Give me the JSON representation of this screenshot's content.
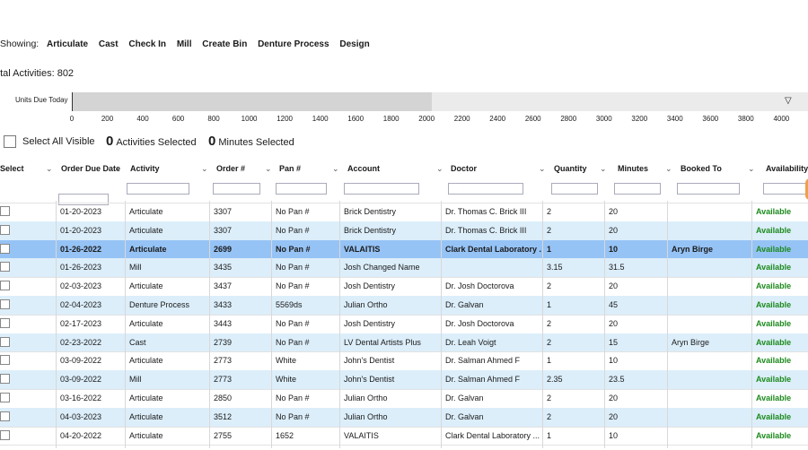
{
  "filters": {
    "label": "Showing:",
    "items": [
      "Articulate",
      "Cast",
      "Check In",
      "Mill",
      "Create Bin",
      "Denture Process",
      "Design"
    ]
  },
  "total_activities": "otal Activities: 802",
  "units_chart": {
    "label": "Units Due Today",
    "axis_ticks": [
      "0",
      "200",
      "400",
      "600",
      "800",
      "1000",
      "1200",
      "1400",
      "1600",
      "1800",
      "2000",
      "2200",
      "2400",
      "2600",
      "2800",
      "3000",
      "3200",
      "3400",
      "3600",
      "3800",
      "4000"
    ],
    "axis_max": 4150,
    "fill_value": 2030
  },
  "select_all_label": "Select All Visible",
  "activities_selected": {
    "count": "0",
    "label": "Activities Selected"
  },
  "minutes_selected": {
    "count": "0",
    "label": "Minutes Selected"
  },
  "columns": [
    "Select",
    "Order Due Date",
    "Activity",
    "Order #",
    "Pan #",
    "Account",
    "Doctor",
    "Quantity",
    "Minutes",
    "Booked To",
    "Availability"
  ],
  "rows": [
    {
      "date": "01-20-2023",
      "activity": "Articulate",
      "order": "3307",
      "pan": "No Pan #",
      "account": "Brick Dentistry",
      "doctor": "Dr. Thomas C. Brick III",
      "qty": "2",
      "min": "20",
      "booked": "",
      "avail": "Available"
    },
    {
      "date": "01-20-2023",
      "activity": "Articulate",
      "order": "3307",
      "pan": "No Pan #",
      "account": "Brick Dentistry",
      "doctor": "Dr. Thomas C. Brick III",
      "qty": "2",
      "min": "20",
      "booked": "",
      "avail": "Available"
    },
    {
      "date": "01-26-2022",
      "activity": "Articulate",
      "order": "2699",
      "pan": "No Pan #",
      "account": "VALAITIS",
      "doctor": "Clark Dental Laboratory ...",
      "qty": "1",
      "min": "10",
      "booked": "Aryn Birge",
      "avail": "Available"
    },
    {
      "date": "01-26-2023",
      "activity": "Mill",
      "order": "3435",
      "pan": "No Pan #",
      "account": "Josh Changed Name",
      "doctor": "",
      "qty": "3.15",
      "min": "31.5",
      "booked": "",
      "avail": "Available"
    },
    {
      "date": "02-03-2023",
      "activity": "Articulate",
      "order": "3437",
      "pan": "No Pan #",
      "account": "Josh Dentistry",
      "doctor": "Dr. Josh Doctorova",
      "qty": "2",
      "min": "20",
      "booked": "",
      "avail": "Available"
    },
    {
      "date": "02-04-2023",
      "activity": "Denture Process",
      "order": "3433",
      "pan": "5569ds",
      "account": "Julian Ortho",
      "doctor": "Dr. Galvan",
      "qty": "1",
      "min": "45",
      "booked": "",
      "avail": "Available"
    },
    {
      "date": "02-17-2023",
      "activity": "Articulate",
      "order": "3443",
      "pan": "No Pan #",
      "account": "Josh Dentistry",
      "doctor": "Dr. Josh Doctorova",
      "qty": "2",
      "min": "20",
      "booked": "",
      "avail": "Available"
    },
    {
      "date": "02-23-2022",
      "activity": "Cast",
      "order": "2739",
      "pan": "No Pan #",
      "account": "LV Dental Artists Plus",
      "doctor": "Dr. Leah Voigt",
      "qty": "2",
      "min": "15",
      "booked": "Aryn Birge",
      "avail": "Available"
    },
    {
      "date": "03-09-2022",
      "activity": "Articulate",
      "order": "2773",
      "pan": "White",
      "account": "John's Dentist",
      "doctor": "Dr. Salman Ahmed F",
      "qty": "1",
      "min": "10",
      "booked": "",
      "avail": "Available"
    },
    {
      "date": "03-09-2022",
      "activity": "Mill",
      "order": "2773",
      "pan": "White",
      "account": "John's Dentist",
      "doctor": "Dr. Salman Ahmed F",
      "qty": "2.35",
      "min": "23.5",
      "booked": "",
      "avail": "Available"
    },
    {
      "date": "03-16-2022",
      "activity": "Articulate",
      "order": "2850",
      "pan": "No Pan #",
      "account": "Julian Ortho",
      "doctor": "Dr. Galvan",
      "qty": "2",
      "min": "20",
      "booked": "",
      "avail": "Available"
    },
    {
      "date": "04-03-2023",
      "activity": "Articulate",
      "order": "3512",
      "pan": "No Pan #",
      "account": "Julian Ortho",
      "doctor": "Dr. Galvan",
      "qty": "2",
      "min": "20",
      "booked": "",
      "avail": "Available"
    },
    {
      "date": "04-20-2022",
      "activity": "Articulate",
      "order": "2755",
      "pan": "1652",
      "account": "VALAITIS",
      "doctor": "Clark Dental Laboratory ...",
      "qty": "1",
      "min": "10",
      "booked": "",
      "avail": "Available"
    }
  ],
  "selected_row_index": 2,
  "colors": {
    "accent_row": "#96c3f5",
    "even_row": "#dceefa",
    "available": "#1c8a1c",
    "chart_fill": "#d4d4d4"
  }
}
